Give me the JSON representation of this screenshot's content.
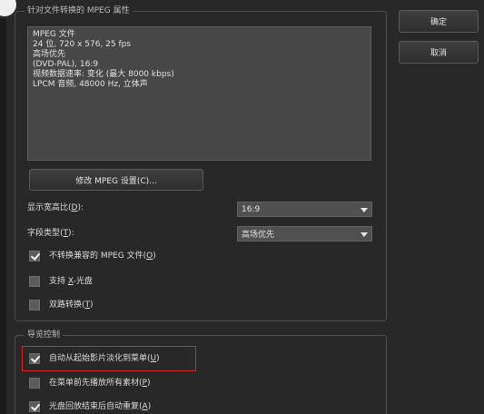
{
  "buttons": {
    "ok": "确定",
    "cancel": "取消",
    "mpeg_settings": "修改 MPEG 设置(C)..."
  },
  "mpeg_group": {
    "title": "针对文件转换的 MPEG 属性",
    "info_lines": [
      "MPEG 文件",
      "24 位, 720 x 576, 25 fps",
      "高场优先",
      "(DVD-PAL), 16:9",
      "视频数据速率: 变化 (最大 8000 kbps)",
      "LPCM 音频, 48000 Hz, 立体声"
    ],
    "aspect_label_prefix": "显示宽高比(",
    "aspect_label_key": "D",
    "aspect_label_suffix": "):",
    "aspect_value": "16:9",
    "field_label_prefix": "字段类型(",
    "field_label_key": "T",
    "field_label_suffix": "):",
    "field_value": "高场优先",
    "checks": [
      {
        "prefix": "不转换兼容的 MPEG 文件(",
        "key": "O",
        "suffix": ")",
        "checked": true
      },
      {
        "prefix": "支持 ",
        "key": "X",
        "suffix": "-光盘",
        "checked": false
      },
      {
        "prefix": "双路转换(",
        "key": "T",
        "suffix": ")",
        "checked": false
      }
    ]
  },
  "nav_group": {
    "title": "导览控制",
    "checks": [
      {
        "prefix": "自动从起始影片淡化到菜单(",
        "key": "U",
        "suffix": ")",
        "checked": true
      },
      {
        "prefix": "在菜单前先播放所有素材(",
        "key": "P",
        "suffix": ")",
        "checked": false
      },
      {
        "prefix": "光盘回放结束后自动重复(",
        "key": "A",
        "suffix": ")",
        "checked": true
      }
    ]
  },
  "colors": {
    "background": "#282828",
    "highlight_border": "#d12a2a"
  }
}
